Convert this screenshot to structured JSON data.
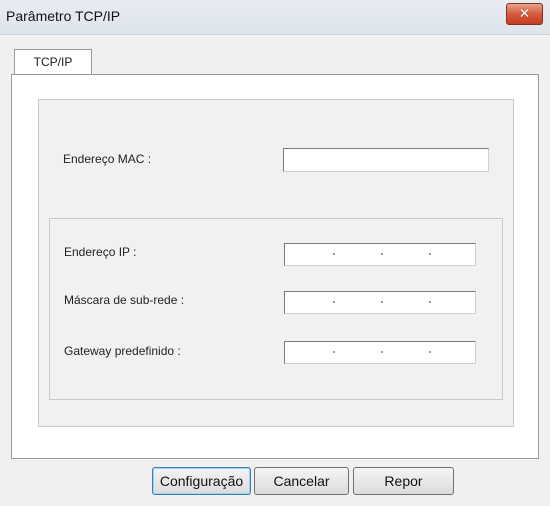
{
  "window": {
    "title": "Parâmetro TCP/IP"
  },
  "tabs": [
    {
      "label": "TCP/IP"
    }
  ],
  "fields": {
    "mac_label": "Endereço MAC :",
    "mac_value": "",
    "ip_label": "Endereço IP :",
    "subnet_label": "Máscara de sub-rede :",
    "gateway_label": "Gateway predefinido :",
    "ip_separator": "."
  },
  "buttons": {
    "configure": "Configuração",
    "cancel": "Cancelar",
    "reset": "Repor"
  },
  "icons": {
    "close": "close-x-icon"
  },
  "colors": {
    "close_button": "#d65a3d",
    "default_button_border": "#3c7fb1"
  }
}
